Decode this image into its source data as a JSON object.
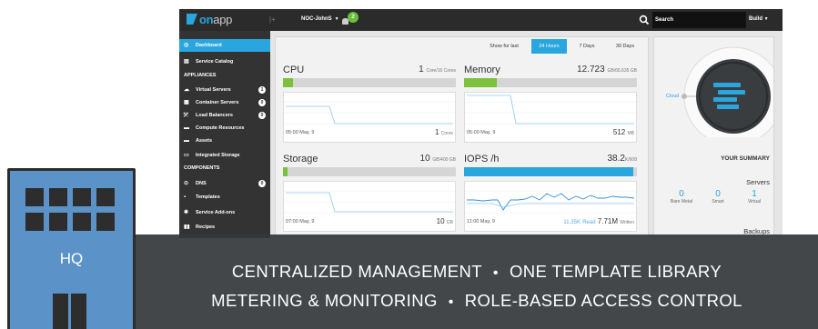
{
  "topbar": {
    "logo_on": "on",
    "logo_app": "app",
    "collapse_glyph": "|+",
    "account_label": "NOC-JohnS",
    "account_caret": "▼",
    "notifications_count": "2",
    "search_placeholder": "Search",
    "build_label": "Build",
    "build_caret": "▼"
  },
  "sidebar": {
    "items_top": [
      {
        "label": "Dashboard",
        "icon": "dashboard-icon",
        "active": true
      },
      {
        "label": "Service Catalog",
        "icon": "catalog-icon"
      }
    ],
    "section_appliances": "APPLIANCES",
    "appliances": [
      {
        "label": "Virtual Servers",
        "icon": "cloud-icon",
        "count": "1"
      },
      {
        "label": "Container Servers",
        "icon": "container-icon",
        "count": "0"
      },
      {
        "label": "Load Balancers",
        "icon": "balancer-icon",
        "count": "0"
      },
      {
        "label": "Compute Resources",
        "icon": "server-icon"
      },
      {
        "label": "Assets",
        "icon": "assets-icon"
      },
      {
        "label": "Integrated Storage",
        "icon": "storage-icon"
      }
    ],
    "section_components": "COMPONENTS",
    "components": [
      {
        "label": "DNS",
        "icon": "dns-icon",
        "count": "0"
      },
      {
        "label": "Templates",
        "icon": "templates-icon"
      },
      {
        "label": "Service Add-ons",
        "icon": "addons-icon"
      },
      {
        "label": "Recipes",
        "icon": "recipes-icon"
      }
    ]
  },
  "time_range": {
    "label": "Show for last",
    "options": [
      "24 Hours",
      "7 Days",
      "30 Days"
    ],
    "selected": "24 Hours"
  },
  "panels": {
    "cpu": {
      "title": "CPU",
      "value": "1",
      "unit": "Core/16 Cores",
      "usage": 0.06,
      "foot_time": "05:00 May, 9",
      "foot_value": "1",
      "foot_unit": "Cores"
    },
    "memory": {
      "title": "Memory",
      "value": "12.723",
      "unit": "GB/65.635 GB",
      "usage": 0.19,
      "foot_time": "05:00 May, 9",
      "foot_value": "512",
      "foot_unit": "MB"
    },
    "storage": {
      "title": "Storage",
      "value": "10",
      "unit": "GB/400 GB",
      "usage": 0.025,
      "foot_time": "07:00 May, 9",
      "foot_value": "10",
      "foot_unit": "GB"
    },
    "iops": {
      "title": "IOPS /h",
      "value": "38.2",
      "unit": "K/608",
      "usage": 0.98,
      "foot_time": "11:00 May, 9",
      "read_value": "11.35K",
      "read_label": "Read",
      "write_value": "7.71M",
      "write_label": "Written"
    }
  },
  "summary": {
    "cloud_label": "Cloud",
    "title": "YOUR SUMMARY",
    "servers_label": "Servers",
    "servers": [
      {
        "count": "0",
        "label": "Bare Metal"
      },
      {
        "count": "0",
        "label": "Smart"
      },
      {
        "count": "1",
        "label": "Virtual"
      }
    ],
    "backups_label": "Backups"
  },
  "banner": {
    "line1_a": "CENTRALIZED MANAGEMENT",
    "line1_b": "ONE TEMPLATE LIBRARY",
    "line2_a": "METERING & MONITORING",
    "line2_b": "ROLE-BASED ACCESS CONTROL",
    "separator": "•"
  },
  "building": {
    "label": "HQ"
  },
  "colors": {
    "accent_blue": "#29a6de",
    "accent_green": "#7cc13e",
    "sidebar_bg": "#333333",
    "banner_bg": "#33373a",
    "building_blue": "#5b93c8"
  }
}
